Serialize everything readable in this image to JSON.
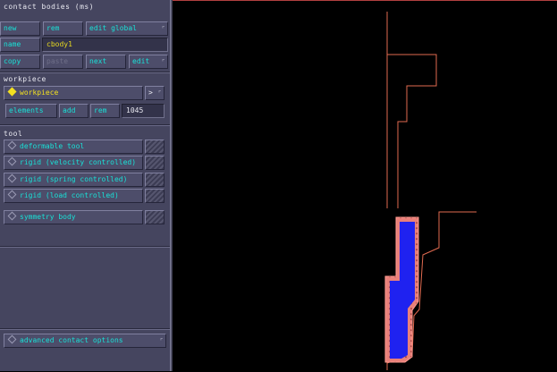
{
  "panel": {
    "title": "contact bodies (ms)",
    "row1": {
      "new": "new",
      "rem": "rem",
      "edit_global": "edit global"
    },
    "row2": {
      "name_label": "name",
      "name_value": "cbody1"
    },
    "row3": {
      "copy": "copy",
      "paste": "paste",
      "next": "next",
      "edit": "edit"
    },
    "workpiece": {
      "section": "workpiece",
      "option": "workpiece",
      "arrow": ">",
      "elements": "elements",
      "add": "add",
      "rem": "rem",
      "count": "1045"
    },
    "tool": {
      "section": "tool",
      "options": [
        "deformable tool",
        "rigid (velocity controlled)",
        "rigid (spring controlled)",
        "rigid (load controlled)",
        "symmetry body"
      ]
    },
    "advanced": "advanced contact options"
  },
  "colors": {
    "panel": "#45455f",
    "button_text": "#19e0d6",
    "field_text": "#e6d820",
    "tool_outline": "#e06a50",
    "workpiece_fill": "#1f22f0",
    "workpiece_border": "#f08a80"
  }
}
